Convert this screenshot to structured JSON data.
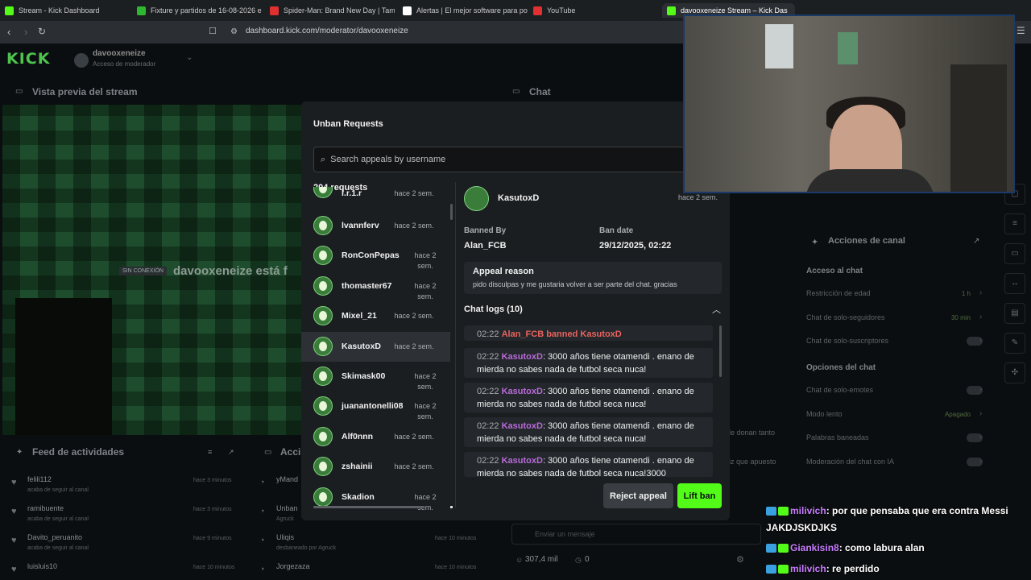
{
  "browser": {
    "tabs": [
      {
        "label": "Stream - Kick Dashboard",
        "color": "#53fc18"
      },
      {
        "label": "Fixture y partidos de 16-08-2026 en",
        "color": "#2eb82e"
      },
      {
        "label": "Spider-Man: Brand New Day | Tame I",
        "color": "#e0302f"
      },
      {
        "label": "Alertas | El mejor software para pote",
        "color": "#ffffff"
      },
      {
        "label": "YouTube",
        "color": "#e0302f"
      },
      {
        "label": "davooxeneize Stream – Kick Das",
        "color": "#53fc18"
      }
    ],
    "url": "dashboard.kick.com/moderator/davooxeneize"
  },
  "dashboard": {
    "logo": "KICK",
    "channel_name": "davooxeneize",
    "channel_role": "Acceso de moderador",
    "preview_title": "Vista previa del stream",
    "chat_title": "Chat",
    "offline_badge": "SIN CONEXIÓN",
    "offline_text": "davooxeneize está f",
    "feed_title": "Feed de actividades",
    "actions_title": "Acci",
    "feed": [
      {
        "name": "felili112",
        "sub": "acaba de seguir al canal",
        "time": "hace 3 minutos"
      },
      {
        "name": "ramibuente",
        "sub": "acaba de seguir al canal",
        "time": "hace 3 minutos"
      },
      {
        "name": "Davito_peruanito",
        "sub": "acaba de seguir al canal",
        "time": "hace 9 minutos"
      },
      {
        "name": "luisluis10",
        "sub": "",
        "time": "hace 10 minutos"
      }
    ],
    "actions": [
      {
        "name": "yMand",
        "sub": ""
      },
      {
        "name": "Unban",
        "sub": "Agruck"
      },
      {
        "name": "Uliqis",
        "sub": "desbaneado por Agruck",
        "time": "hace 10 minutos"
      },
      {
        "name": "Jorgezaza",
        "sub": "",
        "time": "hace 10 minutos"
      }
    ],
    "chat_peek": [
      "le donan tanto",
      "iz que apuesto"
    ],
    "chat_input_placeholder": "Enviar un mensaje",
    "viewers": "307,4 mil",
    "zero_count": "0"
  },
  "right_panel": {
    "title": "Acciones de canal",
    "section1": "Acceso al chat",
    "items1": [
      {
        "label": "Restricción de edad",
        "value": "1 h"
      },
      {
        "label": "Chat de solo-seguidores",
        "value": "30 min"
      },
      {
        "label": "Chat de solo-suscriptores",
        "value": ""
      }
    ],
    "section2": "Opciones del chat",
    "items2": [
      {
        "label": "Chat de solo-emotes",
        "value": ""
      },
      {
        "label": "Modo lento",
        "value": "Apagado"
      },
      {
        "label": "Palabras baneadas",
        "value": ""
      },
      {
        "label": "Moderación del chat con IA",
        "value": ""
      }
    ]
  },
  "modal": {
    "title": "Unban Requests",
    "search_placeholder": "Search appeals by username",
    "count": "204 requests",
    "requests": [
      {
        "name": "l.r.1.r",
        "time": "hace 2 sem."
      },
      {
        "name": "lvannferv",
        "time": "hace 2 sem."
      },
      {
        "name": "RonConPepas",
        "time": "hace 2 sem."
      },
      {
        "name": "thomaster67",
        "time": "hace 2 sem."
      },
      {
        "name": "Mixel_21",
        "time": "hace 2 sem."
      },
      {
        "name": "KasutoxD",
        "time": "hace 2 sem.",
        "selected": true
      },
      {
        "name": "Skimask00",
        "time": "hace 2 sem."
      },
      {
        "name": "juanantonelli08",
        "time": "hace 2 sem."
      },
      {
        "name": "Alf0nnn",
        "time": "hace 2 sem."
      },
      {
        "name": "zshainii",
        "time": "hace 2 sem."
      },
      {
        "name": "Skadion",
        "time": "hace 2 sem."
      }
    ],
    "detail": {
      "username": "KasutoxD",
      "time": "hace 2 sem.",
      "banned_by_label": "Banned By",
      "banned_by": "Alan_FCB",
      "ban_date_label": "Ban date",
      "ban_date": "29/12/2025, 02:22",
      "appeal_label": "Appeal reason",
      "appeal_text": "pido disculpas y me gustaria volver a ser parte del chat. gracias",
      "logs_title": "Chat logs (10)",
      "logs": [
        {
          "time": "02:22",
          "user": "",
          "text": "Alan_FCB banned KasutoxD",
          "type": "ban"
        },
        {
          "time": "02:22",
          "user": "KasutoxD",
          "text": ": 3000 años tiene otamendi . enano de mierda no sabes nada de futbol seca nuca!",
          "type": "msg"
        },
        {
          "time": "02:22",
          "user": "KasutoxD",
          "text": ": 3000 años tiene otamendi . enano de mierda no sabes nada de futbol seca nuca!",
          "type": "msg"
        },
        {
          "time": "02:22",
          "user": "KasutoxD",
          "text": ": 3000 años tiene otamendi . enano de mierda no sabes nada de futbol seca nuca!",
          "type": "msg"
        },
        {
          "time": "02:22",
          "user": "KasutoxD",
          "text": ": 3000 años tiene otamendi . enano de mierda no sabes nada de futbol seca nuca!3000",
          "type": "msg"
        }
      ]
    },
    "reject_label": "Reject appeal",
    "lift_label": "Lift ban"
  },
  "overlay_chat": [
    {
      "user": "milivich",
      "text": ": por que pensaba que era contra Messi JAKDJSKDJKS"
    },
    {
      "user": "Giankisin8",
      "text": ": como labura alan"
    },
    {
      "user": "milivich",
      "text": ": re perdido"
    }
  ]
}
